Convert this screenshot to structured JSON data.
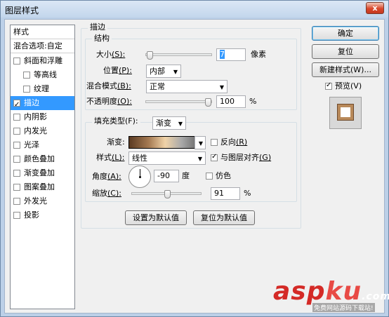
{
  "window": {
    "title": "图层样式",
    "close_glyph": "x"
  },
  "style_list": {
    "header": "样式",
    "blend_options": "混合选项:自定",
    "items": [
      {
        "label": "斜面和浮雕",
        "checked": false
      },
      {
        "label": "等高线",
        "checked": false
      },
      {
        "label": "纹理",
        "checked": false
      },
      {
        "label": "描边",
        "checked": true
      },
      {
        "label": "内阴影",
        "checked": false
      },
      {
        "label": "内发光",
        "checked": false
      },
      {
        "label": "光泽",
        "checked": false
      },
      {
        "label": "颜色叠加",
        "checked": false
      },
      {
        "label": "渐变叠加",
        "checked": false
      },
      {
        "label": "图案叠加",
        "checked": false
      },
      {
        "label": "外发光",
        "checked": false
      },
      {
        "label": "投影",
        "checked": false
      }
    ]
  },
  "stroke": {
    "group_title": "描边",
    "structure_title": "结构",
    "size": {
      "label": "大小",
      "shortcut": "(S):",
      "value": "7",
      "unit": "像素"
    },
    "position": {
      "label": "位置",
      "shortcut": "(P):",
      "value": "内部"
    },
    "blend_mode": {
      "label": "混合模式",
      "shortcut": "(B):",
      "value": "正常"
    },
    "opacity": {
      "label": "不透明度",
      "shortcut": "(O):",
      "value": "100",
      "unit": "%"
    },
    "fill_type": {
      "label": "填充类型(F):",
      "value": "渐变"
    },
    "gradient": {
      "label": "渐变:",
      "reverse_label": "反向",
      "reverse_shortcut": "(R)",
      "reverse_checked": false
    },
    "style": {
      "label": "样式",
      "shortcut": "(L):",
      "value": "线性",
      "align_label": "与图层对齐",
      "align_shortcut": "(G)",
      "align_checked": true
    },
    "angle": {
      "label": "角度",
      "shortcut": "(A):",
      "value": "-90",
      "unit": "度",
      "dither_label": "仿色",
      "dither_checked": false
    },
    "scale": {
      "label": "缩放",
      "shortcut": "(C):",
      "value": "91",
      "unit": "%"
    },
    "make_default": "设置为默认值",
    "reset_default": "复位为默认值"
  },
  "buttons": {
    "ok": "确定",
    "reset": "复位",
    "new_style": "新建样式(W)...",
    "preview_label": "预览(V)",
    "preview_checked": true
  },
  "watermark": {
    "main": "asp",
    "accent": "ku",
    "suffix": ".com",
    "sub": "免费网站源码下载站!"
  },
  "colors": {
    "selection": "#3399ff",
    "title_bg": "#c3d6ec"
  }
}
